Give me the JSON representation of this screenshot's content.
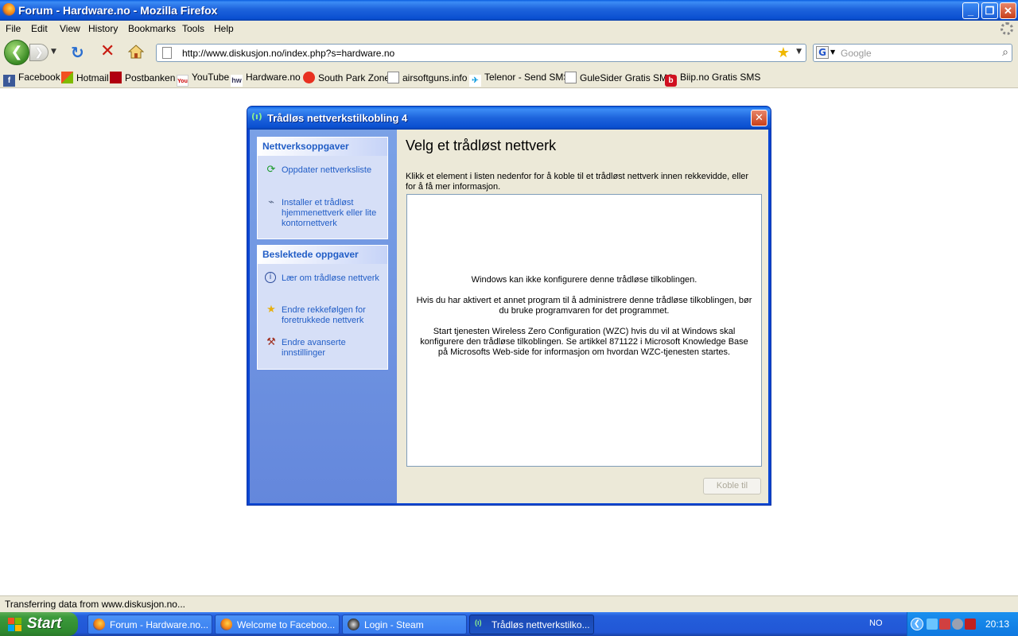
{
  "window": {
    "title": "Forum - Hardware.no - Mozilla Firefox"
  },
  "menu": [
    "File",
    "Edit",
    "View",
    "History",
    "Bookmarks",
    "Tools",
    "Help"
  ],
  "nav": {
    "url": "http://www.diskusjon.no/index.php?s=hardware.no",
    "search_placeholder": "Google",
    "search_engine": "G"
  },
  "bookmarks": [
    "Facebook",
    "Hotmail",
    "Postbanken",
    "YouTube",
    "Hardware.no",
    "South Park Zone",
    "airsoftguns.info",
    "Telenor - Send SMS",
    "GuleSider Gratis SMS",
    "Biip.no Gratis SMS"
  ],
  "dialog": {
    "title": "Trådløs nettverkstilkobling 4",
    "heading": "Velg et trådløst nettverk",
    "description": "Klikk et element i listen nedenfor for å koble til et trådløst nettverk innen rekkevidde, eller for å få mer informasjon.",
    "network_tasks": {
      "header": "Nettverksoppgaver",
      "items": [
        "Oppdater nettverksliste",
        "Installer et trådløst hjemmenettverk eller lite kontornettverk"
      ]
    },
    "related_tasks": {
      "header": "Beslektede oppgaver",
      "items": [
        "Lær om trådløse nettverk",
        "Endre rekkefølgen for foretrukkede nettverk",
        "Endre avanserte innstillinger"
      ]
    },
    "messages": [
      "Windows kan ikke konfigurere denne trådløse tilkoblingen.",
      "Hvis du har aktivert et annet program til å administrere denne trådløse tilkoblingen, bør du bruke programvaren for det programmet.",
      "Start tjenesten Wireless Zero Configuration (WZC) hvis du vil at Windows skal konfigurere den trådløse tilkoblingen. Se artikkel 871122 i Microsoft Knowledge Base på Microsofts Web-side for informasjon om hvordan WZC-tjenesten startes."
    ],
    "connect_button": "Koble til"
  },
  "status": {
    "text": "Transferring data from www.diskusjon.no..."
  },
  "taskbar": {
    "start": "Start",
    "tasks": [
      "Forum - Hardware.no...",
      "Welcome to Faceboo...",
      "Login - Steam",
      "Trådløs nettverkstilko..."
    ],
    "language": "NO",
    "clock": "20:13"
  },
  "colors": {
    "xp_blue": "#0a46d2",
    "link_blue": "#215dc6",
    "chrome": "#ece9d8",
    "start_green": "#3c9a3c"
  }
}
